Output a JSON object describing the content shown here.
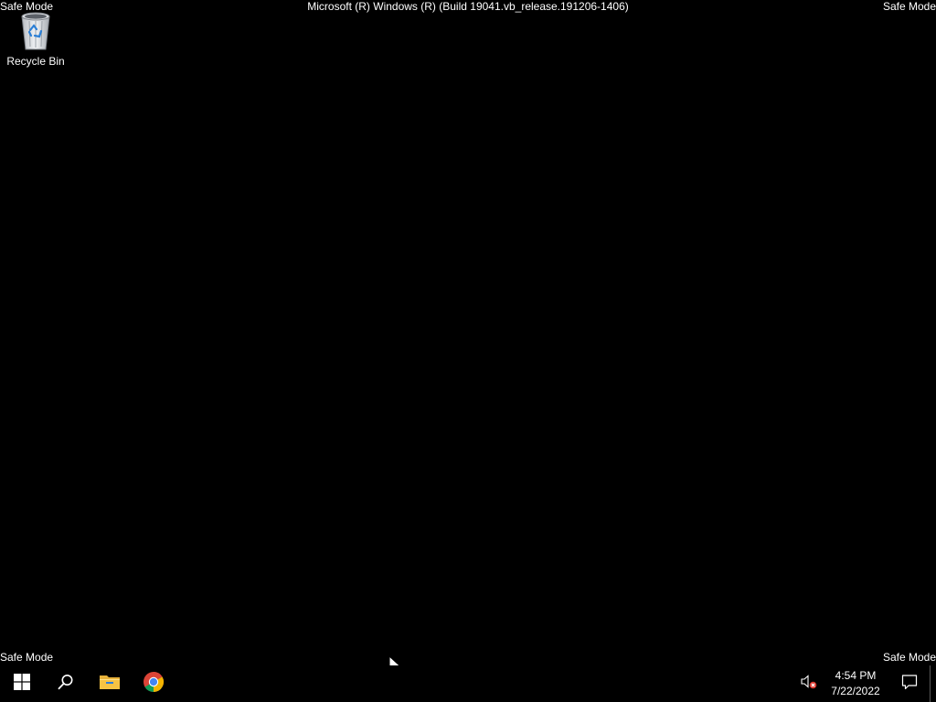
{
  "watermarks": {
    "top_left": "Safe Mode",
    "top_right": "Safe Mode",
    "bottom_left": "Safe Mode",
    "bottom_right": "Safe Mode",
    "title": "Microsoft (R) Windows (R) (Build 19041.vb_release.191206-1406)"
  },
  "desktop": {
    "icons": [
      {
        "label": "Recycle Bin",
        "icon": "recycle-bin-icon"
      }
    ]
  },
  "taskbar": {
    "buttons": [
      {
        "name": "start-button",
        "icon": "windows-logo-icon"
      },
      {
        "name": "search-button",
        "icon": "search-icon"
      },
      {
        "name": "file-explorer-button",
        "icon": "folder-icon"
      },
      {
        "name": "chrome-button",
        "icon": "chrome-icon"
      }
    ],
    "tray": {
      "volume_icon": "volume-muted-icon",
      "time": "4:54 PM",
      "date": "7/22/2022",
      "notification_icon": "action-center-icon"
    }
  },
  "colors": {
    "background": "#000000",
    "text": "#ffffff",
    "windows_blue": "#ffffff",
    "folder_yellow": "#f6c343",
    "mute_red": "#d9342b"
  }
}
